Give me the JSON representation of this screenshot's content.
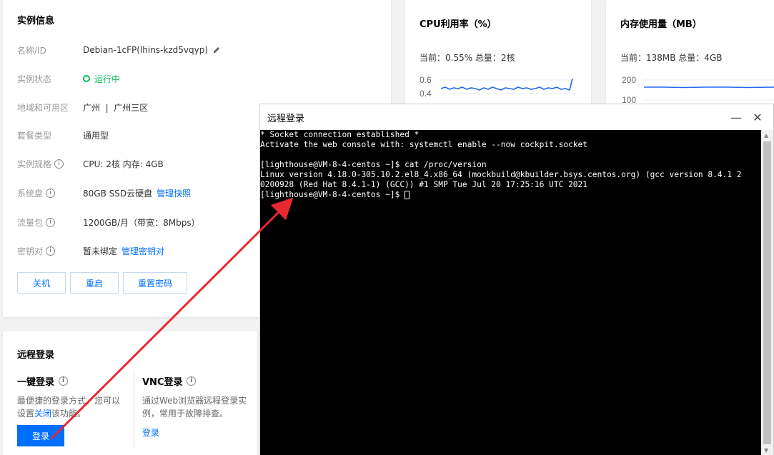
{
  "info_card": {
    "title": "实例信息",
    "rows": [
      {
        "label": "名称/ID",
        "value": "Debian-1cFP(lhins-kzd5vqyp)"
      },
      {
        "label": "实例状态",
        "value": "运行中"
      },
      {
        "label": "地域和可用区",
        "value": "广州  |  广州三区"
      },
      {
        "label": "套餐类型",
        "value": "通用型"
      },
      {
        "label": "实例规格",
        "value": "CPU: 2核 内存: 4GB"
      },
      {
        "label": "系统盘",
        "value": "80GB SSD云硬盘",
        "link": "管理快照"
      },
      {
        "label": "流量包",
        "value": "1200GB/月（带宽：8Mbps）"
      },
      {
        "label": "密钥对",
        "value": "暂未绑定",
        "link": "管理密钥对"
      }
    ],
    "buttons": {
      "shutdown": "关机",
      "restart": "重启",
      "reset_password": "重置密码"
    }
  },
  "cpu_card": {
    "title": "CPU利用率（%）",
    "summary": "当前：0.55% 总量：2核",
    "y_ticks": [
      "0.6",
      "0.4"
    ]
  },
  "mem_card": {
    "title": "内存使用量（MB）",
    "summary": "当前：138MB 总量：4GB",
    "y_ticks": [
      "200",
      "100"
    ]
  },
  "login_card": {
    "title": "远程登录",
    "one_click": {
      "title": "一键登录",
      "desc_1": "最便捷的登录方式，您可以",
      "desc_2_pre": "设置",
      "desc_2_link": "关闭",
      "desc_2_post": "该功能。",
      "button": "登录"
    },
    "vnc": {
      "title": "VNC登录",
      "desc_1": "通过Web浏览器远程登录实",
      "desc_2": "例，常用于故障排查。",
      "link": "登录"
    }
  },
  "terminal": {
    "title": "远程登录",
    "lines": [
      "* Socket connection established *",
      "Activate the web console with: systemctl enable --now cockpit.socket",
      "",
      "[lighthouse@VM-8-4-centos ~]$ cat /proc/version",
      "Linux version 4.18.0-305.10.2.el8_4.x86_64 (mockbuild@kbuilder.bsys.centos.org) (gcc version 8.4.1 2",
      "0200928 (Red Hat 8.4.1-1) (GCC)) #1 SMP Tue Jul 20 17:25:16 UTC 2021",
      "[lighthouse@VM-8-4-centos ~]$ "
    ]
  },
  "colors": {
    "accent": "#006eff",
    "status_green": "#0abf5b",
    "annotation_arrow": "#e8272e",
    "terminal_bg": "#000000"
  }
}
